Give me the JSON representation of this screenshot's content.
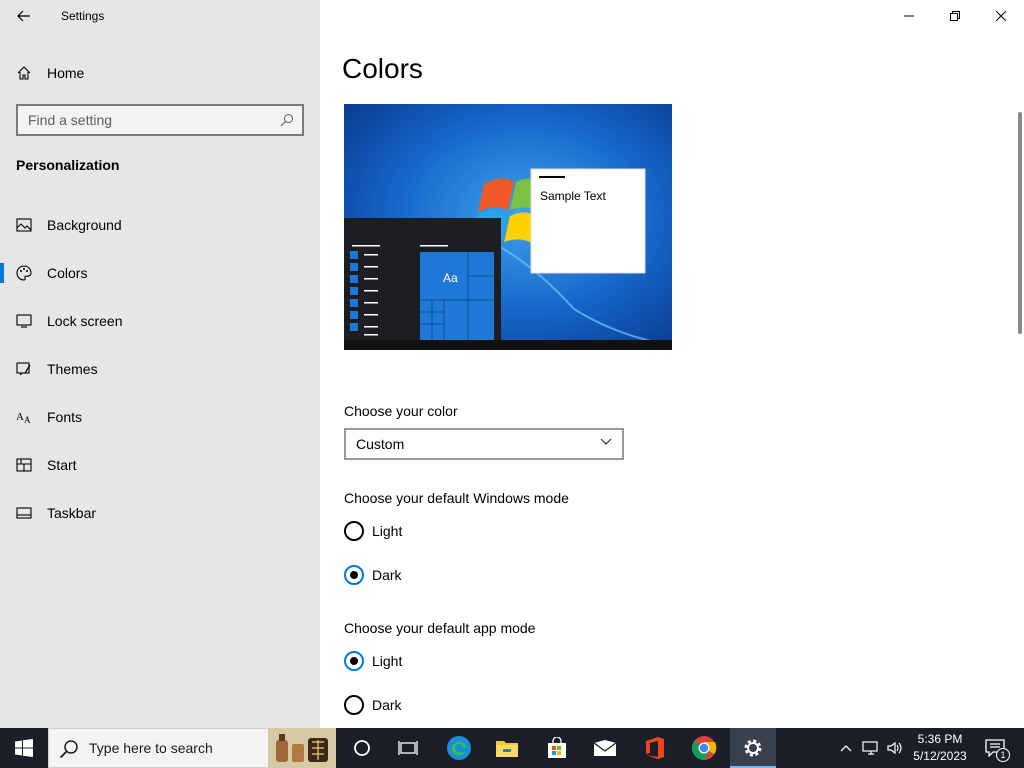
{
  "window": {
    "title": "Settings",
    "controls": {
      "minimize": "minimize-icon",
      "maximize": "restore-icon",
      "close": "close-icon"
    }
  },
  "sidebar": {
    "home_label": "Home",
    "search_placeholder": "Find a setting",
    "section_title": "Personalization",
    "items": [
      {
        "label": "Background",
        "icon": "picture-icon"
      },
      {
        "label": "Colors",
        "icon": "palette-icon",
        "selected": true
      },
      {
        "label": "Lock screen",
        "icon": "monitor-icon"
      },
      {
        "label": "Themes",
        "icon": "brush-icon"
      },
      {
        "label": "Fonts",
        "icon": "font-icon"
      },
      {
        "label": "Start",
        "icon": "start-tiles-icon"
      },
      {
        "label": "Taskbar",
        "icon": "taskbar-icon"
      }
    ]
  },
  "main": {
    "page_title": "Colors",
    "preview": {
      "sample_text": "Sample Text",
      "tile_text": "Aa"
    },
    "choose_color": {
      "label": "Choose your color",
      "selected_value": "Custom"
    },
    "windows_mode": {
      "label": "Choose your default Windows mode",
      "options": [
        {
          "label": "Light",
          "checked": false
        },
        {
          "label": "Dark",
          "checked": true
        }
      ]
    },
    "app_mode": {
      "label": "Choose your default app mode",
      "options": [
        {
          "label": "Light",
          "checked": true
        },
        {
          "label": "Dark",
          "checked": false
        }
      ]
    }
  },
  "taskbar": {
    "search_placeholder": "Type here to search",
    "time": "5:36 PM",
    "date": "5/12/2023",
    "notification_count": "1",
    "apps": [
      "cortana-icon",
      "task-view-icon",
      "edge-icon",
      "file-explorer-icon",
      "store-icon",
      "mail-icon",
      "office-icon",
      "chrome-icon",
      "settings-icon"
    ]
  },
  "colors": {
    "accent": "#0078d7",
    "sidebar_bg": "#e6e6e6",
    "taskbar_bg": "#1b1f2a"
  }
}
